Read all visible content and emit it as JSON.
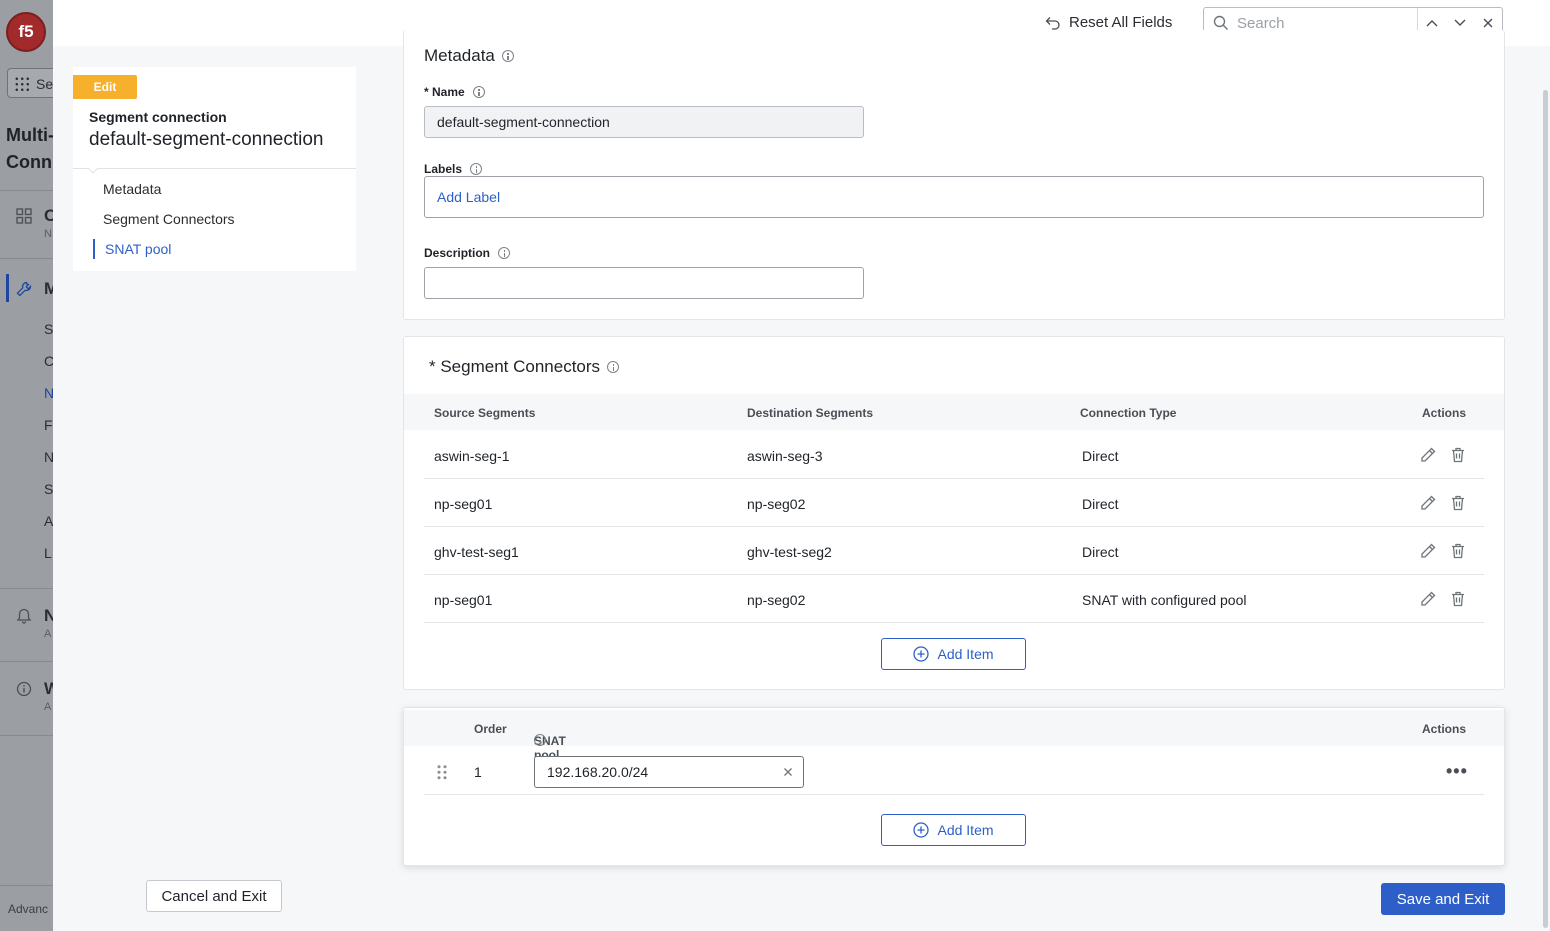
{
  "background_app": {
    "logo": "f5",
    "switcher_label": "Se",
    "title_lines": [
      "Multi-",
      "Conn"
    ],
    "sections": [
      {
        "icon": "grid-icon",
        "label": "C",
        "sub": "N"
      },
      {
        "icon": "wrench-icon",
        "label": "M",
        "sub": ""
      },
      {
        "icon": "bell-icon",
        "label": "N",
        "sub": "A"
      },
      {
        "icon": "info-icon",
        "label": "W",
        "sub": "A"
      }
    ],
    "items": [
      "S",
      "C",
      "N",
      "F",
      "N",
      "S",
      "A",
      "L"
    ],
    "footer": "Advanc"
  },
  "topbar": {
    "reset_label": "Reset All Fields",
    "search_placeholder": "Search"
  },
  "sidebar": {
    "badge": "Edit",
    "object_type": "Segment connection",
    "object_name": "default-segment-connection",
    "links": [
      "Metadata",
      "Segment Connectors",
      "SNAT pool"
    ],
    "active_link": "SNAT pool",
    "cancel_label": "Cancel and Exit"
  },
  "metadata": {
    "title": "Metadata",
    "name_label": "* Name",
    "name_value": "default-segment-connection",
    "labels_label": "Labels",
    "add_label": "Add Label",
    "description_label": "Description",
    "description_value": ""
  },
  "segment_connectors": {
    "title": "* Segment Connectors",
    "columns": [
      "Source Segments",
      "Destination Segments",
      "Connection Type",
      "Actions"
    ],
    "rows": [
      {
        "source": "aswin-seg-1",
        "destination": "aswin-seg-3",
        "type": "Direct"
      },
      {
        "source": "np-seg01",
        "destination": "np-seg02",
        "type": "Direct"
      },
      {
        "source": "ghv-test-seg1",
        "destination": "ghv-test-seg2",
        "type": "Direct"
      },
      {
        "source": "np-seg01",
        "destination": "np-seg02",
        "type": "SNAT with configured pool"
      }
    ],
    "add_label": "Add Item"
  },
  "snat_pool": {
    "columns": [
      "Order",
      "SNAT pool",
      "Actions"
    ],
    "rows": [
      {
        "order": "1",
        "value": "192.168.20.0/24"
      }
    ],
    "add_label": "Add Item"
  },
  "footer": {
    "save_label": "Save and Exit"
  },
  "colors": {
    "accent": "#2e5fc8",
    "badge": "#f7b02c",
    "overlay": "#9b9ea3"
  }
}
